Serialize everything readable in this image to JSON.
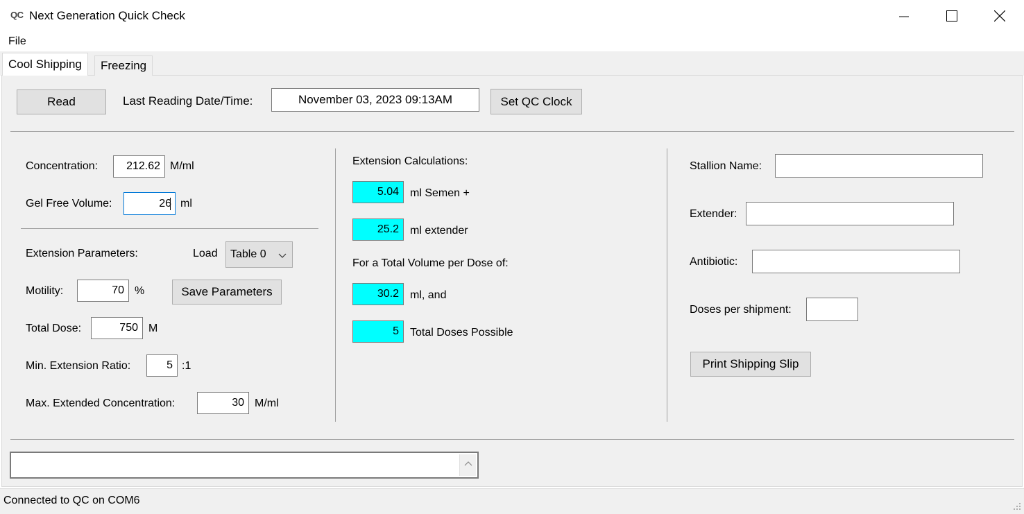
{
  "window": {
    "icon_text": "QC",
    "title": "Next Generation Quick Check",
    "minimize_glyph": "—",
    "maximize_glyph": "☐",
    "close_glyph": "✕"
  },
  "menu": {
    "file": "File"
  },
  "tabs": [
    {
      "label": "Cool Shipping",
      "active": true
    },
    {
      "label": "Freezing",
      "active": false
    }
  ],
  "top_row": {
    "read_button": "Read",
    "last_reading_label": "Last Reading Date/Time:",
    "last_reading_value": "November 03, 2023 09:13AM",
    "set_clock_button": "Set QC Clock"
  },
  "left": {
    "concentration_label": "Concentration:",
    "concentration_value": "212.62",
    "concentration_unit": "M/ml",
    "gel_free_label": "Gel Free Volume:",
    "gel_free_value": "26",
    "gel_free_unit": "ml",
    "ext_params_label": "Extension Parameters:",
    "load_label": "Load",
    "load_select_value": "Table 0",
    "motility_label": "Motility:",
    "motility_value": "70",
    "motility_unit": "%",
    "save_params_button": "Save Parameters",
    "total_dose_label": "Total Dose:",
    "total_dose_value": "750",
    "total_dose_unit": "M",
    "min_ratio_label": "Min. Extension Ratio:",
    "min_ratio_value": "5",
    "min_ratio_unit": ":1",
    "max_conc_label": "Max. Extended Concentration:",
    "max_conc_value": "30",
    "max_conc_unit": "M/ml"
  },
  "middle": {
    "title": "Extension Calculations:",
    "semen_value": "5.04",
    "semen_label": "ml Semen +",
    "extender_value": "25.2",
    "extender_label": "ml extender",
    "total_volume_label": "For a Total Volume per Dose of:",
    "total_volume_value": "30.2",
    "total_volume_unit": "ml, and",
    "doses_value": "5",
    "doses_label": "Total Doses Possible"
  },
  "right": {
    "stallion_label": "Stallion Name:",
    "stallion_value": "",
    "extender_label": "Extender:",
    "extender_value": "",
    "antibiotic_label": "Antibiotic:",
    "antibiotic_value": "",
    "doses_label": "Doses per shipment:",
    "doses_value": "",
    "print_button": "Print Shipping Slip"
  },
  "log": {
    "value": ""
  },
  "status": {
    "text": "Connected to QC on COM6"
  },
  "colors": {
    "result_box": "#00ffff",
    "panel": "#f0f0f0",
    "focus": "#0078d7"
  }
}
